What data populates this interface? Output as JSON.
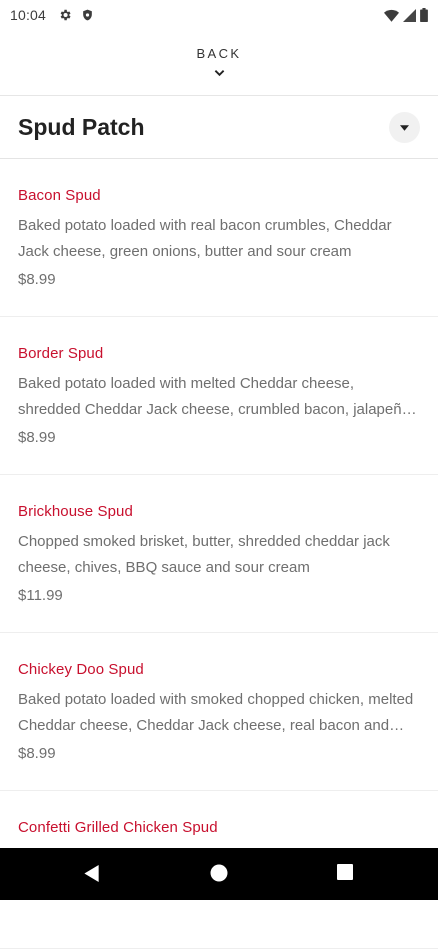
{
  "status_bar": {
    "time": "10:04",
    "left_icons": [
      "gear-icon",
      "shield-icon"
    ],
    "right_icons": [
      "wifi-icon",
      "signal-icon",
      "battery-icon"
    ]
  },
  "header": {
    "back_label": "BACK"
  },
  "category": {
    "title": "Spud Patch"
  },
  "items": [
    {
      "name": "Bacon Spud",
      "description": "Baked potato loaded with real bacon crumbles, Cheddar Jack cheese, green onions, butter and sour cream",
      "price": "$8.99"
    },
    {
      "name": "Border Spud",
      "description": "Baked potato loaded with melted Cheddar cheese, shredded Cheddar Jack cheese, crumbled bacon, jalapeños and sour cream",
      "price": "$8.99"
    },
    {
      "name": "Brickhouse Spud",
      "description": "Chopped smoked brisket, butter, shredded cheddar jack cheese, chives, BBQ sauce and sour cream",
      "price": "$11.99"
    },
    {
      "name": "Chickey Doo Spud",
      "description": "Baked potato loaded with smoked chopped chicken, melted Cheddar cheese, Cheddar Jack cheese, real bacon and sour cream",
      "price": "$8.99"
    },
    {
      "name": "Confetti Grilled Chicken Spud",
      "description": "",
      "price": ""
    }
  ],
  "colors": {
    "item_name": "#c8102e",
    "text_muted": "#6f6f6f",
    "title": "#222222",
    "nav_bar": "#000000"
  },
  "nav": [
    "back-triangle-icon",
    "home-circle-icon",
    "recents-square-icon"
  ]
}
